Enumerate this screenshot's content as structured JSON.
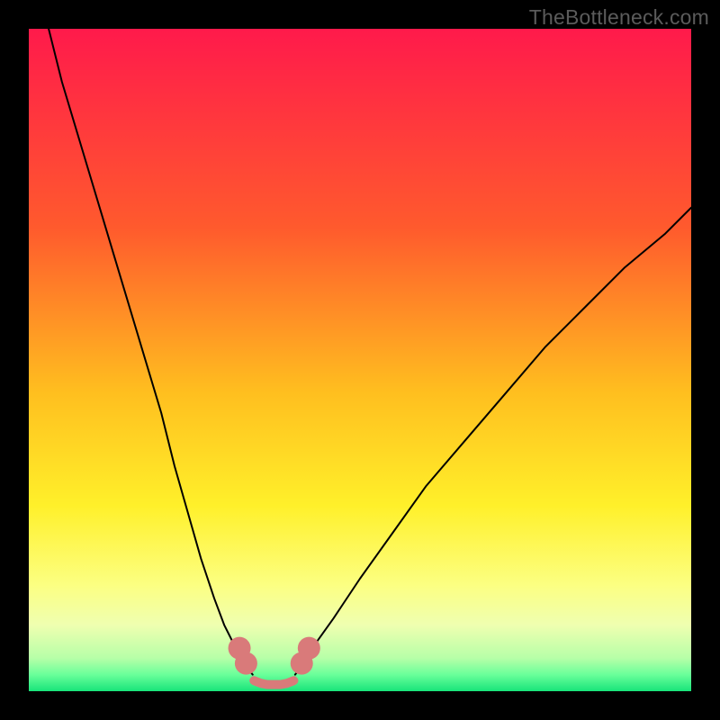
{
  "watermark": "TheBottleneck.com",
  "chart_data": {
    "type": "line",
    "title": "",
    "xlabel": "",
    "ylabel": "",
    "xlim": [
      0,
      100
    ],
    "ylim": [
      0,
      100
    ],
    "background_gradient": [
      {
        "stop": 0.0,
        "color": "#ff1a4b"
      },
      {
        "stop": 0.3,
        "color": "#ff5a2d"
      },
      {
        "stop": 0.55,
        "color": "#ffbf1f"
      },
      {
        "stop": 0.72,
        "color": "#fff02a"
      },
      {
        "stop": 0.84,
        "color": "#fcff82"
      },
      {
        "stop": 0.9,
        "color": "#efffb0"
      },
      {
        "stop": 0.95,
        "color": "#b7ffa8"
      },
      {
        "stop": 0.975,
        "color": "#6aff9a"
      },
      {
        "stop": 1.0,
        "color": "#18e47a"
      }
    ],
    "series": [
      {
        "name": "left-curve",
        "stroke": "#000000",
        "width": 2,
        "x": [
          3,
          5,
          8,
          11,
          14,
          17,
          20,
          22,
          24,
          26,
          28,
          29.5,
          31,
          32,
          33,
          33.8
        ],
        "y": [
          100,
          92,
          82,
          72,
          62,
          52,
          42,
          34,
          27,
          20,
          14,
          10,
          7,
          5,
          3.5,
          2.5
        ]
      },
      {
        "name": "right-curve",
        "stroke": "#000000",
        "width": 2,
        "x": [
          40.2,
          41,
          42,
          43.5,
          46,
          50,
          55,
          60,
          66,
          72,
          78,
          84,
          90,
          96,
          100
        ],
        "y": [
          2.5,
          3.5,
          5,
          7.5,
          11,
          17,
          24,
          31,
          38,
          45,
          52,
          58,
          64,
          69,
          73
        ]
      },
      {
        "name": "valley-floor",
        "stroke": "#d97a7a",
        "width": 10,
        "x": [
          34,
          35,
          36,
          37,
          38,
          39,
          40
        ],
        "y": [
          1.6,
          1.2,
          1.0,
          1.0,
          1.0,
          1.2,
          1.6
        ]
      }
    ],
    "markers": [
      {
        "name": "left-bead-upper",
        "cx": 31.8,
        "cy": 6.5,
        "r": 1.7,
        "fill": "#d97a7a"
      },
      {
        "name": "left-bead-lower",
        "cx": 32.8,
        "cy": 4.2,
        "r": 1.7,
        "fill": "#d97a7a"
      },
      {
        "name": "right-bead-upper",
        "cx": 42.3,
        "cy": 6.5,
        "r": 1.7,
        "fill": "#d97a7a"
      },
      {
        "name": "right-bead-lower",
        "cx": 41.2,
        "cy": 4.2,
        "r": 1.7,
        "fill": "#d97a7a"
      }
    ]
  }
}
